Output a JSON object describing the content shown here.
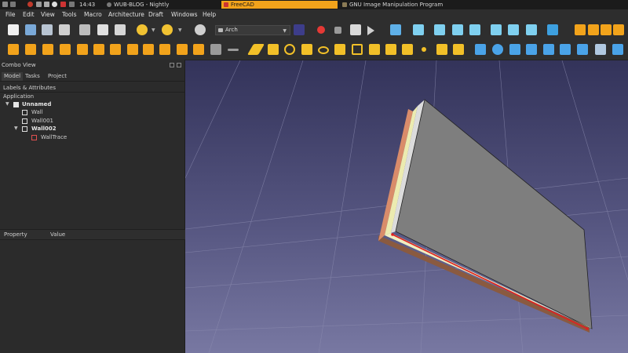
{
  "taskbar": {
    "clock": "14:43",
    "tasks": [
      {
        "label": "WUB-BLOG - Nightly",
        "active": false
      },
      {
        "label": "FreeCAD",
        "active": true
      },
      {
        "label": "GNU Image Manipulation Program",
        "active": false
      }
    ]
  },
  "menubar": {
    "items": [
      "File",
      "Edit",
      "View",
      "Tools",
      "Macro",
      "Architecture",
      "Draft",
      "Windows",
      "Help"
    ]
  },
  "toolbar": {
    "workbench_value": "Arch"
  },
  "combo_view": {
    "title": "Combo View",
    "tabs": [
      "Model",
      "Tasks",
      "Project"
    ],
    "section": "Labels & Attributes",
    "root_label": "Application",
    "tree": [
      {
        "label": "Unnamed",
        "bold": true,
        "icon": "document-icon"
      },
      {
        "label": "Wall",
        "bold": false,
        "icon": "wall-icon"
      },
      {
        "label": "Wall001",
        "bold": false,
        "icon": "wall-icon"
      },
      {
        "label": "Wall002",
        "bold": true,
        "icon": "wall-icon"
      },
      {
        "label": "WallTrace",
        "bold": false,
        "icon": "wire-icon"
      }
    ],
    "property_headers": [
      "Property",
      "Value"
    ]
  },
  "colors": {
    "accent": "#f2a31b",
    "viewport_top": "#33335a",
    "viewport_bottom": "#7878a2",
    "wall_top": "#808080",
    "wall_edge": "#e6e6e6",
    "trace_line": "#e02020"
  }
}
